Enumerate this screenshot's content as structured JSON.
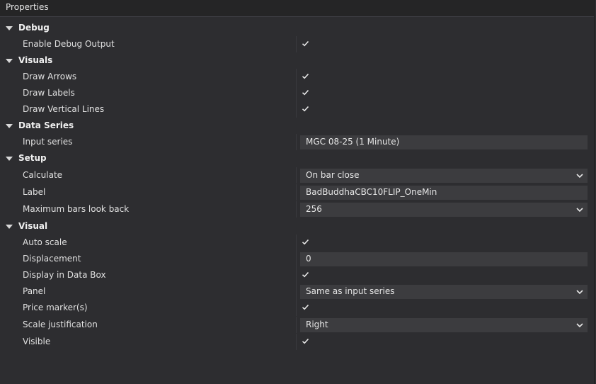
{
  "panel": {
    "title": "Properties"
  },
  "categories": {
    "debug": "Debug",
    "visuals": "Visuals",
    "data_series": "Data Series",
    "setup": "Setup",
    "visual": "Visual"
  },
  "props": {
    "enable_debug_output": {
      "label": "Enable Debug Output",
      "checked": true
    },
    "draw_arrows": {
      "label": "Draw Arrows",
      "checked": true
    },
    "draw_labels": {
      "label": "Draw Labels",
      "checked": true
    },
    "draw_vertical_lines": {
      "label": "Draw Vertical Lines",
      "checked": true
    },
    "input_series": {
      "label": "Input series",
      "value": "MGC 08-25 (1 Minute)"
    },
    "calculate": {
      "label": "Calculate",
      "value": "On bar close"
    },
    "label": {
      "label": "Label",
      "value": "BadBuddhaCBC10FLIP_OneMin"
    },
    "maximum_bars_look_back": {
      "label": "Maximum bars look back",
      "value": "256"
    },
    "auto_scale": {
      "label": "Auto scale",
      "checked": true
    },
    "displacement": {
      "label": "Displacement",
      "value": "0"
    },
    "display_in_data_box": {
      "label": "Display in Data Box",
      "checked": true
    },
    "panel": {
      "label": "Panel",
      "value": "Same as input series"
    },
    "price_markers": {
      "label": "Price marker(s)",
      "checked": true
    },
    "scale_justification": {
      "label": "Scale justification",
      "value": "Right"
    },
    "visible": {
      "label": "Visible",
      "checked": true
    }
  },
  "colors": {
    "background": "#2d2d30",
    "titlebar": "#252526",
    "field": "#3c3c3f",
    "text": "#e6e6e6"
  },
  "icons": {
    "expand": "triangle-down-icon",
    "checkbox": "checkmark-icon",
    "dropdown": "chevron-down-icon"
  }
}
